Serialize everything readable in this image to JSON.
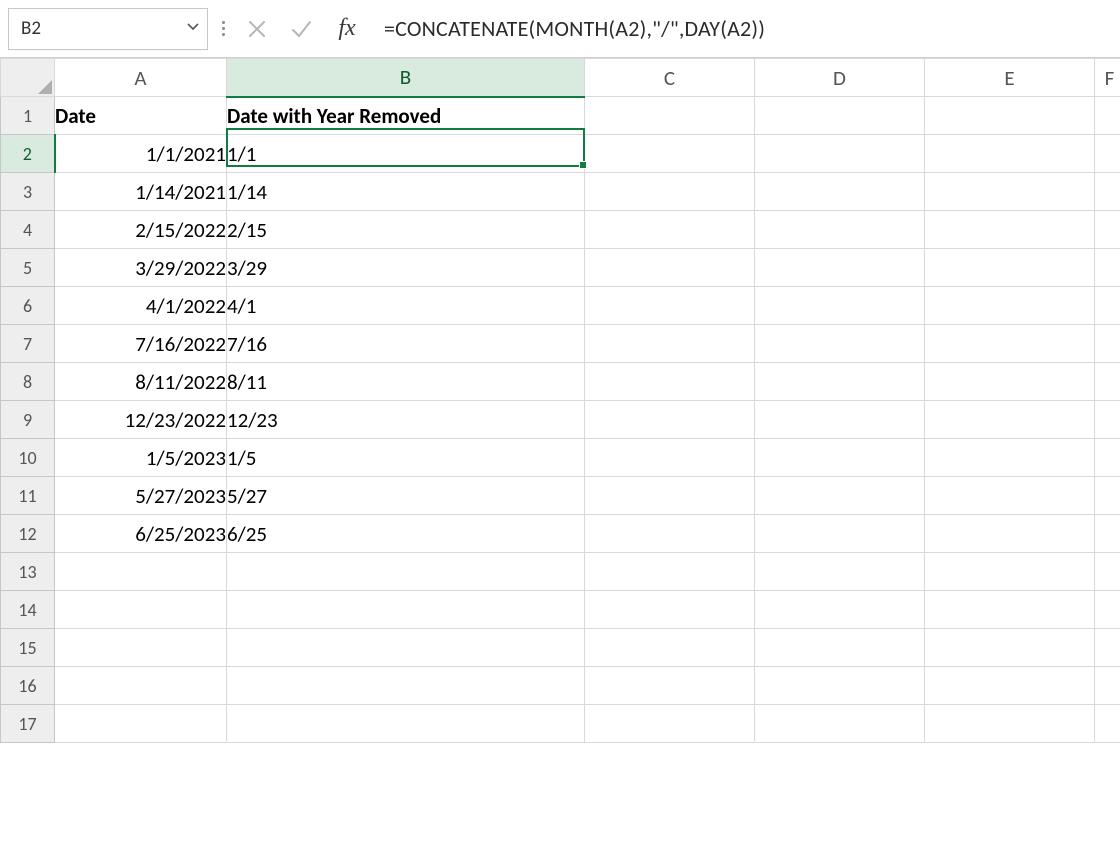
{
  "namebox": {
    "value": "B2"
  },
  "formula": {
    "value": "=CONCATENATE(MONTH(A2),\"/\",DAY(A2))"
  },
  "columns": [
    "A",
    "B",
    "C",
    "D",
    "E",
    "F"
  ],
  "active": {
    "row": 2,
    "col": "B"
  },
  "headers": {
    "A": "Date",
    "B": "Date with Year Removed"
  },
  "rows": [
    {
      "n": 1,
      "A": "Date",
      "B": "Date with Year Removed"
    },
    {
      "n": 2,
      "A": "1/1/2021",
      "B": "1/1"
    },
    {
      "n": 3,
      "A": "1/14/2021",
      "B": "1/14"
    },
    {
      "n": 4,
      "A": "2/15/2022",
      "B": "2/15"
    },
    {
      "n": 5,
      "A": "3/29/2022",
      "B": "3/29"
    },
    {
      "n": 6,
      "A": "4/1/2022",
      "B": "4/1"
    },
    {
      "n": 7,
      "A": "7/16/2022",
      "B": "7/16"
    },
    {
      "n": 8,
      "A": "8/11/2022",
      "B": "8/11"
    },
    {
      "n": 9,
      "A": "12/23/2022",
      "B": "12/23"
    },
    {
      "n": 10,
      "A": "1/5/2023",
      "B": "1/5"
    },
    {
      "n": 11,
      "A": "5/27/2023",
      "B": "5/27"
    },
    {
      "n": 12,
      "A": "6/25/2023",
      "B": "6/25"
    },
    {
      "n": 13,
      "A": "",
      "B": ""
    },
    {
      "n": 14,
      "A": "",
      "B": ""
    },
    {
      "n": 15,
      "A": "",
      "B": ""
    },
    {
      "n": 16,
      "A": "",
      "B": ""
    },
    {
      "n": 17,
      "A": "",
      "B": ""
    }
  ],
  "chart_data": {
    "type": "table",
    "title": "Date with Year Removed",
    "columns": [
      "Date",
      "Date with Year Removed"
    ],
    "rows": [
      [
        "1/1/2021",
        "1/1"
      ],
      [
        "1/14/2021",
        "1/14"
      ],
      [
        "2/15/2022",
        "2/15"
      ],
      [
        "3/29/2022",
        "3/29"
      ],
      [
        "4/1/2022",
        "4/1"
      ],
      [
        "7/16/2022",
        "7/16"
      ],
      [
        "8/11/2022",
        "8/11"
      ],
      [
        "12/23/2022",
        "12/23"
      ],
      [
        "1/5/2023",
        "1/5"
      ],
      [
        "5/27/2023",
        "5/27"
      ],
      [
        "6/25/2023",
        "6/25"
      ]
    ]
  }
}
